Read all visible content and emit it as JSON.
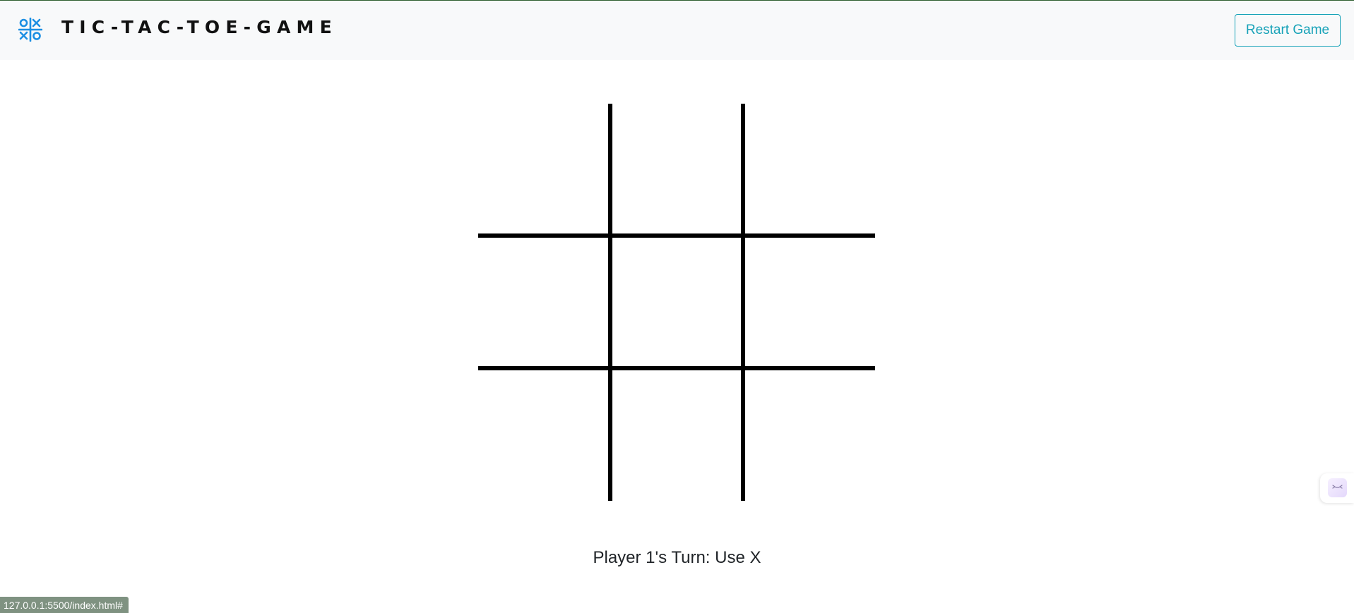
{
  "navbar": {
    "brand": "TIC-TAC-TOE-GAME",
    "logo_icon": "tic-tac-toe-logo-icon",
    "restart_label": "Restart Game"
  },
  "board": {
    "cells": [
      "",
      "",
      "",
      "",
      "",
      "",
      "",
      "",
      ""
    ]
  },
  "status": {
    "text": "Player 1's Turn: Use X"
  },
  "browser": {
    "status_url": "127.0.0.1:5500/index.html#"
  },
  "extension": {
    "icon": "extension-face-icon"
  },
  "colors": {
    "accent": "#17a2b8",
    "logo": "#1c8fe3",
    "navbar_bg": "#f8f9fa",
    "grid": "#000000"
  }
}
